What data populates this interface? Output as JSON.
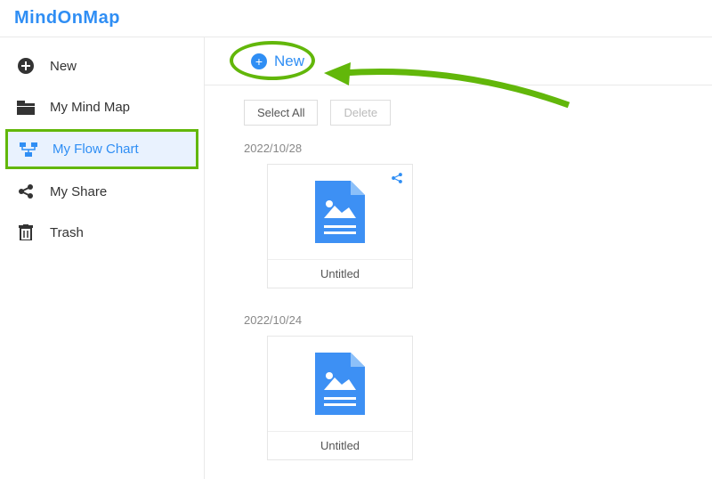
{
  "logo": {
    "text": "MindOnMap"
  },
  "sidebar": {
    "items": [
      {
        "label": "New",
        "icon": "plus-circle-icon"
      },
      {
        "label": "My Mind Map",
        "icon": "folder-icon"
      },
      {
        "label": "My Flow Chart",
        "icon": "flowchart-icon",
        "active": true
      },
      {
        "label": "My Share",
        "icon": "share-icon"
      },
      {
        "label": "Trash",
        "icon": "trash-icon"
      }
    ]
  },
  "main": {
    "new_label": "New",
    "toolbar": {
      "select_all": "Select All",
      "delete": "Delete"
    },
    "groups": [
      {
        "date": "2022/10/28",
        "items": [
          {
            "title": "Untitled",
            "has_share": true
          }
        ]
      },
      {
        "date": "2022/10/24",
        "items": [
          {
            "title": "Untitled",
            "has_share": false
          }
        ]
      }
    ]
  },
  "colors": {
    "accent": "#2f8ef4",
    "highlight": "#62b70a"
  }
}
